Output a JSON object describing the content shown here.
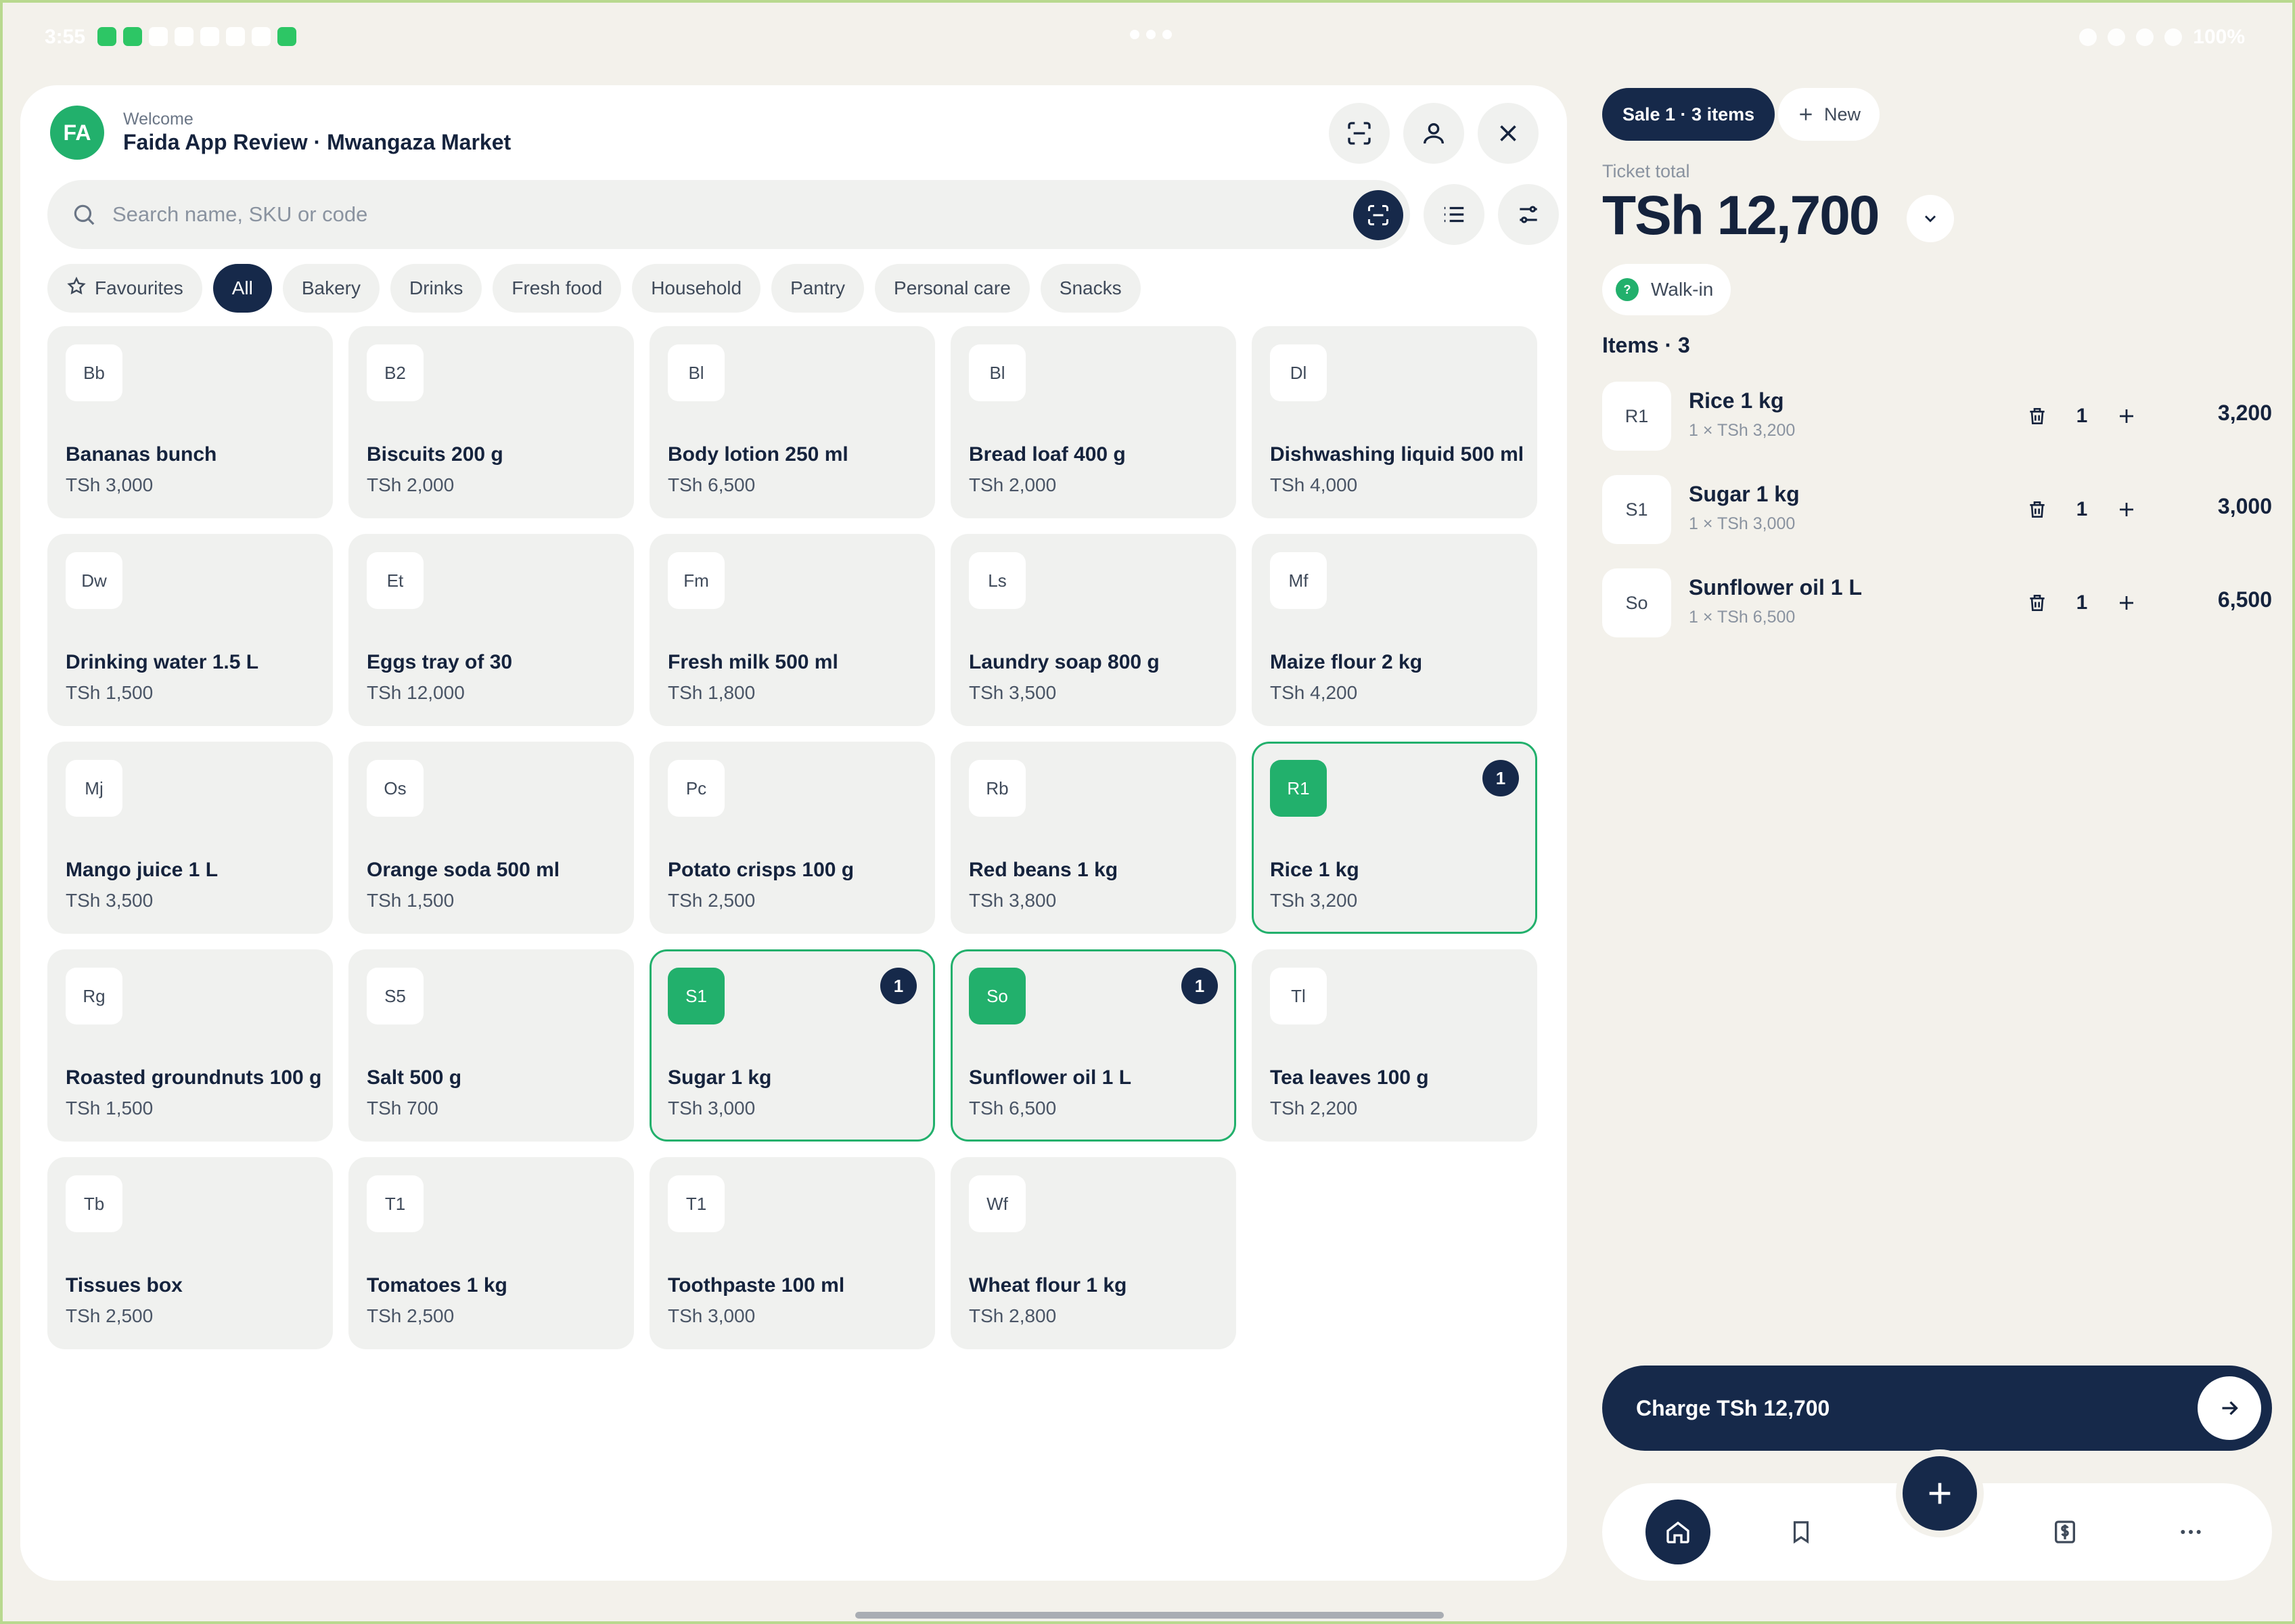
{
  "status_bar": {
    "time": "3:55",
    "battery": "100%"
  },
  "header": {
    "avatar_initials": "FA",
    "welcome": "Welcome",
    "store_name": "Faida App Review · Mwangaza Market"
  },
  "search": {
    "placeholder": "Search name, SKU or code"
  },
  "categories": [
    {
      "label": "Favourites",
      "icon": "star-icon",
      "active": false
    },
    {
      "label": "All",
      "active": true
    },
    {
      "label": "Bakery",
      "active": false
    },
    {
      "label": "Drinks",
      "active": false
    },
    {
      "label": "Fresh food",
      "active": false
    },
    {
      "label": "Household",
      "active": false
    },
    {
      "label": "Pantry",
      "active": false
    },
    {
      "label": "Personal care",
      "active": false
    },
    {
      "label": "Snacks",
      "active": false
    }
  ],
  "products": [
    {
      "code": "Bb",
      "name": "Bananas bunch",
      "price": "TSh 3,000"
    },
    {
      "code": "B2",
      "name": "Biscuits 200 g",
      "price": "TSh 2,000"
    },
    {
      "code": "Bl",
      "name": "Body lotion 250 ml",
      "price": "TSh 6,500"
    },
    {
      "code": "Bl",
      "name": "Bread loaf 400 g",
      "price": "TSh 2,000"
    },
    {
      "code": "Dl",
      "name": "Dishwashing liquid 500 ml",
      "price": "TSh 4,000"
    },
    {
      "code": "Dw",
      "name": "Drinking water 1.5 L",
      "price": "TSh 1,500"
    },
    {
      "code": "Et",
      "name": "Eggs tray of 30",
      "price": "TSh 12,000"
    },
    {
      "code": "Fm",
      "name": "Fresh milk 500 ml",
      "price": "TSh 1,800"
    },
    {
      "code": "Ls",
      "name": "Laundry soap 800 g",
      "price": "TSh 3,500"
    },
    {
      "code": "Mf",
      "name": "Maize flour 2 kg",
      "price": "TSh 4,200"
    },
    {
      "code": "Mj",
      "name": "Mango juice 1 L",
      "price": "TSh 3,500"
    },
    {
      "code": "Os",
      "name": "Orange soda 500 ml",
      "price": "TSh 1,500"
    },
    {
      "code": "Pc",
      "name": "Potato crisps 100 g",
      "price": "TSh 2,500"
    },
    {
      "code": "Rb",
      "name": "Red beans 1 kg",
      "price": "TSh 3,800"
    },
    {
      "code": "R1",
      "name": "Rice 1 kg",
      "price": "TSh 3,200",
      "qty": "1"
    },
    {
      "code": "Rg",
      "name": "Roasted groundnuts 100 g",
      "price": "TSh 1,500"
    },
    {
      "code": "S5",
      "name": "Salt 500 g",
      "price": "TSh 700"
    },
    {
      "code": "S1",
      "name": "Sugar 1 kg",
      "price": "TSh 3,000",
      "qty": "1"
    },
    {
      "code": "So",
      "name": "Sunflower oil 1 L",
      "price": "TSh 6,500",
      "qty": "1"
    },
    {
      "code": "Tl",
      "name": "Tea leaves 100 g",
      "price": "TSh 2,200"
    },
    {
      "code": "Tb",
      "name": "Tissues box",
      "price": "TSh 2,500"
    },
    {
      "code": "T1",
      "name": "Tomatoes 1 kg",
      "price": "TSh 2,500"
    },
    {
      "code": "T1",
      "name": "Toothpaste 100 ml",
      "price": "TSh 3,000"
    },
    {
      "code": "Wf",
      "name": "Wheat flour 1 kg",
      "price": "TSh 2,800"
    }
  ],
  "ticket": {
    "sale_tab": "Sale 1 · 3 items",
    "new_tab": "New",
    "total_label": "Ticket total",
    "total": "TSh 12,700",
    "customer": "Walk-in",
    "customer_badge": "?",
    "items_heading": "Items · 3",
    "items": [
      {
        "code": "R1",
        "name": "Rice 1 kg",
        "unit": "1 × TSh 3,200",
        "qty": "1",
        "total": "3,200"
      },
      {
        "code": "S1",
        "name": "Sugar 1 kg",
        "unit": "1 × TSh 3,000",
        "qty": "1",
        "total": "3,000"
      },
      {
        "code": "So",
        "name": "Sunflower oil 1 L",
        "unit": "1 × TSh 6,500",
        "qty": "1",
        "total": "6,500"
      }
    ],
    "charge_label": "Charge TSh 12,700"
  },
  "colors": {
    "brand_green": "#22b06c",
    "navy": "#16294a",
    "background": "#f3f1eb"
  }
}
